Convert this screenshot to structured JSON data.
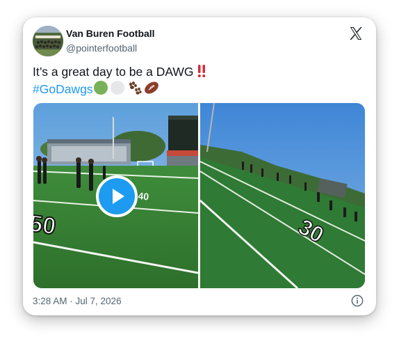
{
  "author": {
    "name": "Van Buren Football",
    "handle": "@pointerfootball",
    "avatar_icon": "team-photo-avatar"
  },
  "tweet": {
    "text": "It’s a great day to be a DAWG",
    "hashtag": "#GoDawgs",
    "emojis": [
      "double-exclamation-icon",
      "green-circle-icon",
      "white-circle-icon",
      "paw-prints-icon",
      "football-icon"
    ]
  },
  "media": {
    "left_image": "football-field-stadium-photo",
    "right_image": "football-field-yard-line-photo",
    "yard_number_left": "50",
    "yard_number_right": "30",
    "play_icon": "play-icon"
  },
  "footer": {
    "timestamp": "3:28 AM · Jul 7, 2026",
    "info_icon": "info-icon"
  },
  "colors": {
    "hashtag": "#1d9bf0",
    "play_button": "#1d9bf0",
    "name": "#0f1419",
    "secondary": "#536471"
  }
}
